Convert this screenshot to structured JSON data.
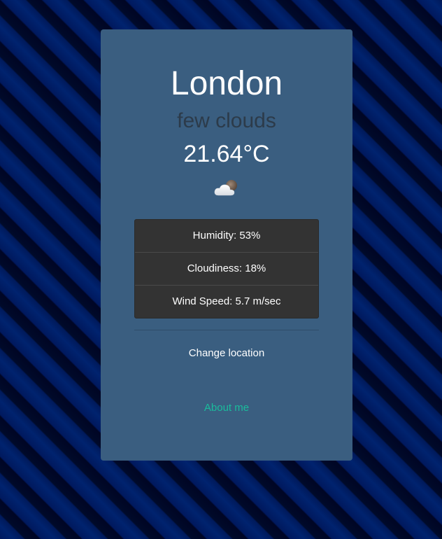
{
  "weather": {
    "city": "London",
    "description": "few clouds",
    "temperature": "21.64°C",
    "icon": "few-clouds-night-icon"
  },
  "stats": [
    {
      "label": "Humidity: 53%"
    },
    {
      "label": "Cloudiness: 18%"
    },
    {
      "label": "Wind Speed: 5.7 m/sec"
    }
  ],
  "actions": {
    "change_location": "Change location",
    "about": "About me"
  },
  "colors": {
    "card_background": "#3a5e80",
    "stats_background": "#333333",
    "description_text": "#2c3b4a",
    "link_accent": "#1abc9c"
  }
}
